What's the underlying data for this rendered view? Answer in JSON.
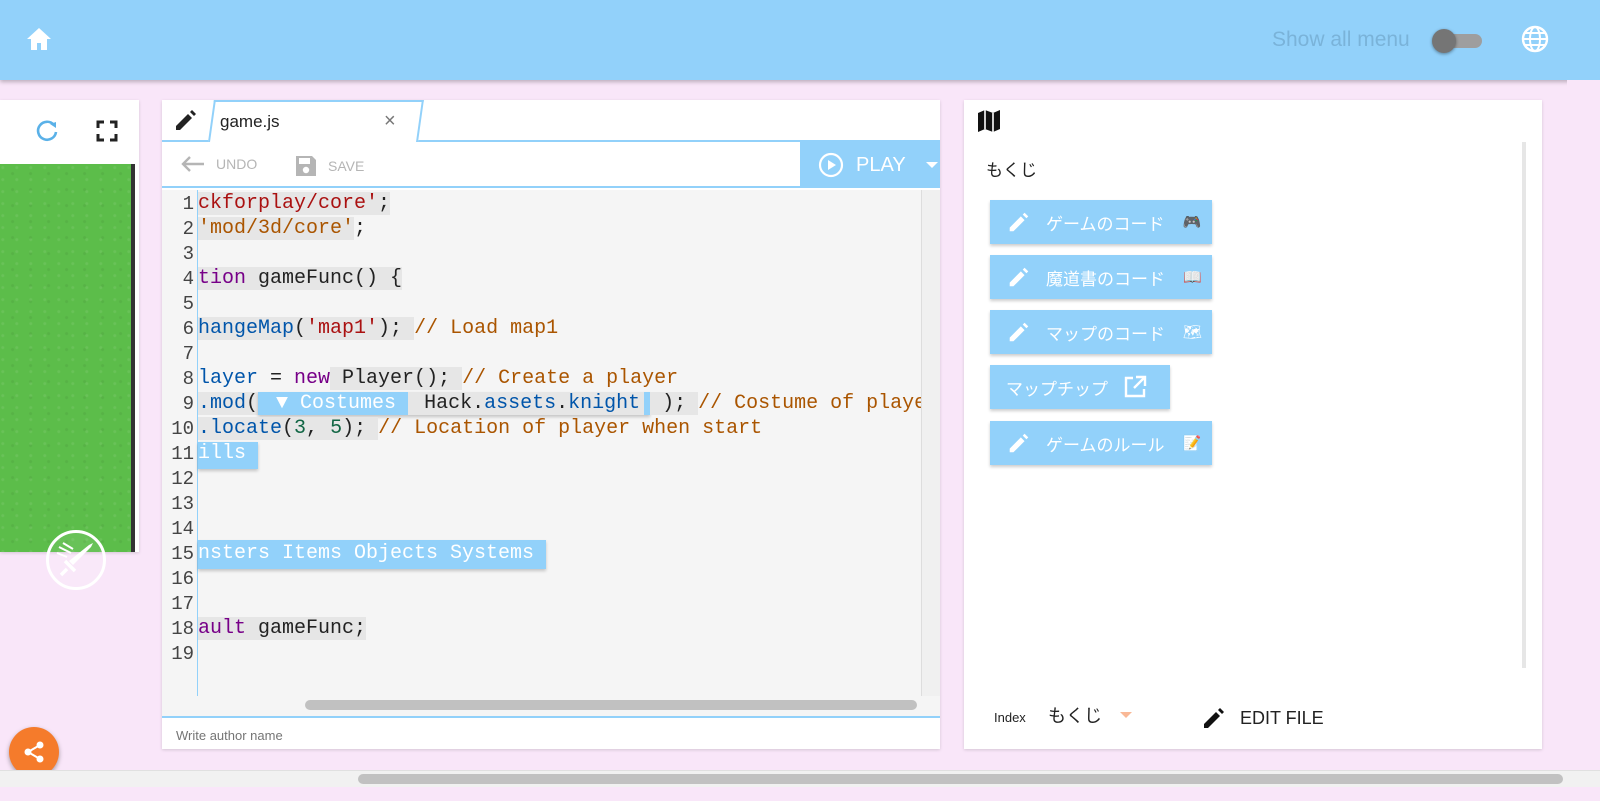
{
  "header": {
    "show_all_menu_label": "Show all menu",
    "show_all_menu_on": false,
    "home_icon": "home-icon",
    "language_icon": "globe-icon"
  },
  "preview": {
    "reload_icon": "reload-icon",
    "fullscreen_icon": "fullscreen-icon",
    "skill_icon": "sword-icon"
  },
  "editor": {
    "tab_filename": "game.js",
    "tab_close": "×",
    "undo_label": "UNDO",
    "save_label": "SAVE",
    "play_label": "PLAY",
    "author_placeholder": "Write author name",
    "line_numbers": [
      "1",
      "2",
      "3",
      "4",
      "5",
      "6",
      "7",
      "8",
      "9",
      "10",
      "11",
      "12",
      "13",
      "14",
      "15",
      "16",
      "17",
      "18",
      "19"
    ],
    "code": {
      "l1_a": "ckforplay/core'",
      "l1_b": ";",
      "l2_a": "'mod/3d/core'",
      "l2_b": ";",
      "l4_a": "tion",
      "l4_b": " gameFunc() {",
      "l6_a": "hangeMap",
      "l6_b": "(",
      "l6_c": "'map1'",
      "l6_d": "); ",
      "l6_e": "// Load map1",
      "l8_a": "layer",
      "l8_b": " = ",
      "l8_c": "new",
      "l8_d": " Player(); ",
      "l8_e": "// Create a player",
      "l9_a": ".mod",
      "l9_b": "(",
      "l9_chip": " ▼ Costumes ",
      "l9_c": " Hack.",
      "l9_d": "assets",
      "l9_e": ".",
      "l9_f": "knight",
      "l9_g": " ); ",
      "l9_h": "// Costume of player",
      "l10_a": ".locate",
      "l10_b": "(",
      "l10_c": "3",
      "l10_d": ", ",
      "l10_e": "5",
      "l10_f": "); ",
      "l10_g": "// Location of player when start",
      "l11_chip": "ills ",
      "l15_chip": "nsters Items Objects Systems ",
      "l18_a": "ault",
      "l18_b": " gameFunc;"
    }
  },
  "docs": {
    "map_icon": "map-icon",
    "toc_title": "もくじ",
    "buttons": [
      {
        "label": "ゲームのコード",
        "emoji": "🎮",
        "icon": "pencil-icon"
      },
      {
        "label": "魔道書のコード",
        "emoji": "📖",
        "icon": "pencil-icon"
      },
      {
        "label": "マップのコード",
        "emoji": "🗺",
        "icon": "pencil-icon"
      },
      {
        "label": "マップチップ",
        "emoji": "",
        "icon": "external-link-icon"
      },
      {
        "label": "ゲームのルール",
        "emoji": "📝",
        "icon": "pencil-icon"
      }
    ],
    "index_label": "Index",
    "index_value": "もくじ",
    "edit_file_label": "EDIT FILE"
  },
  "share": {
    "icon": "share-icon"
  },
  "colors": {
    "accent": "#92d1fa",
    "share": "#f57b2b",
    "background": "#f9e6f9"
  }
}
